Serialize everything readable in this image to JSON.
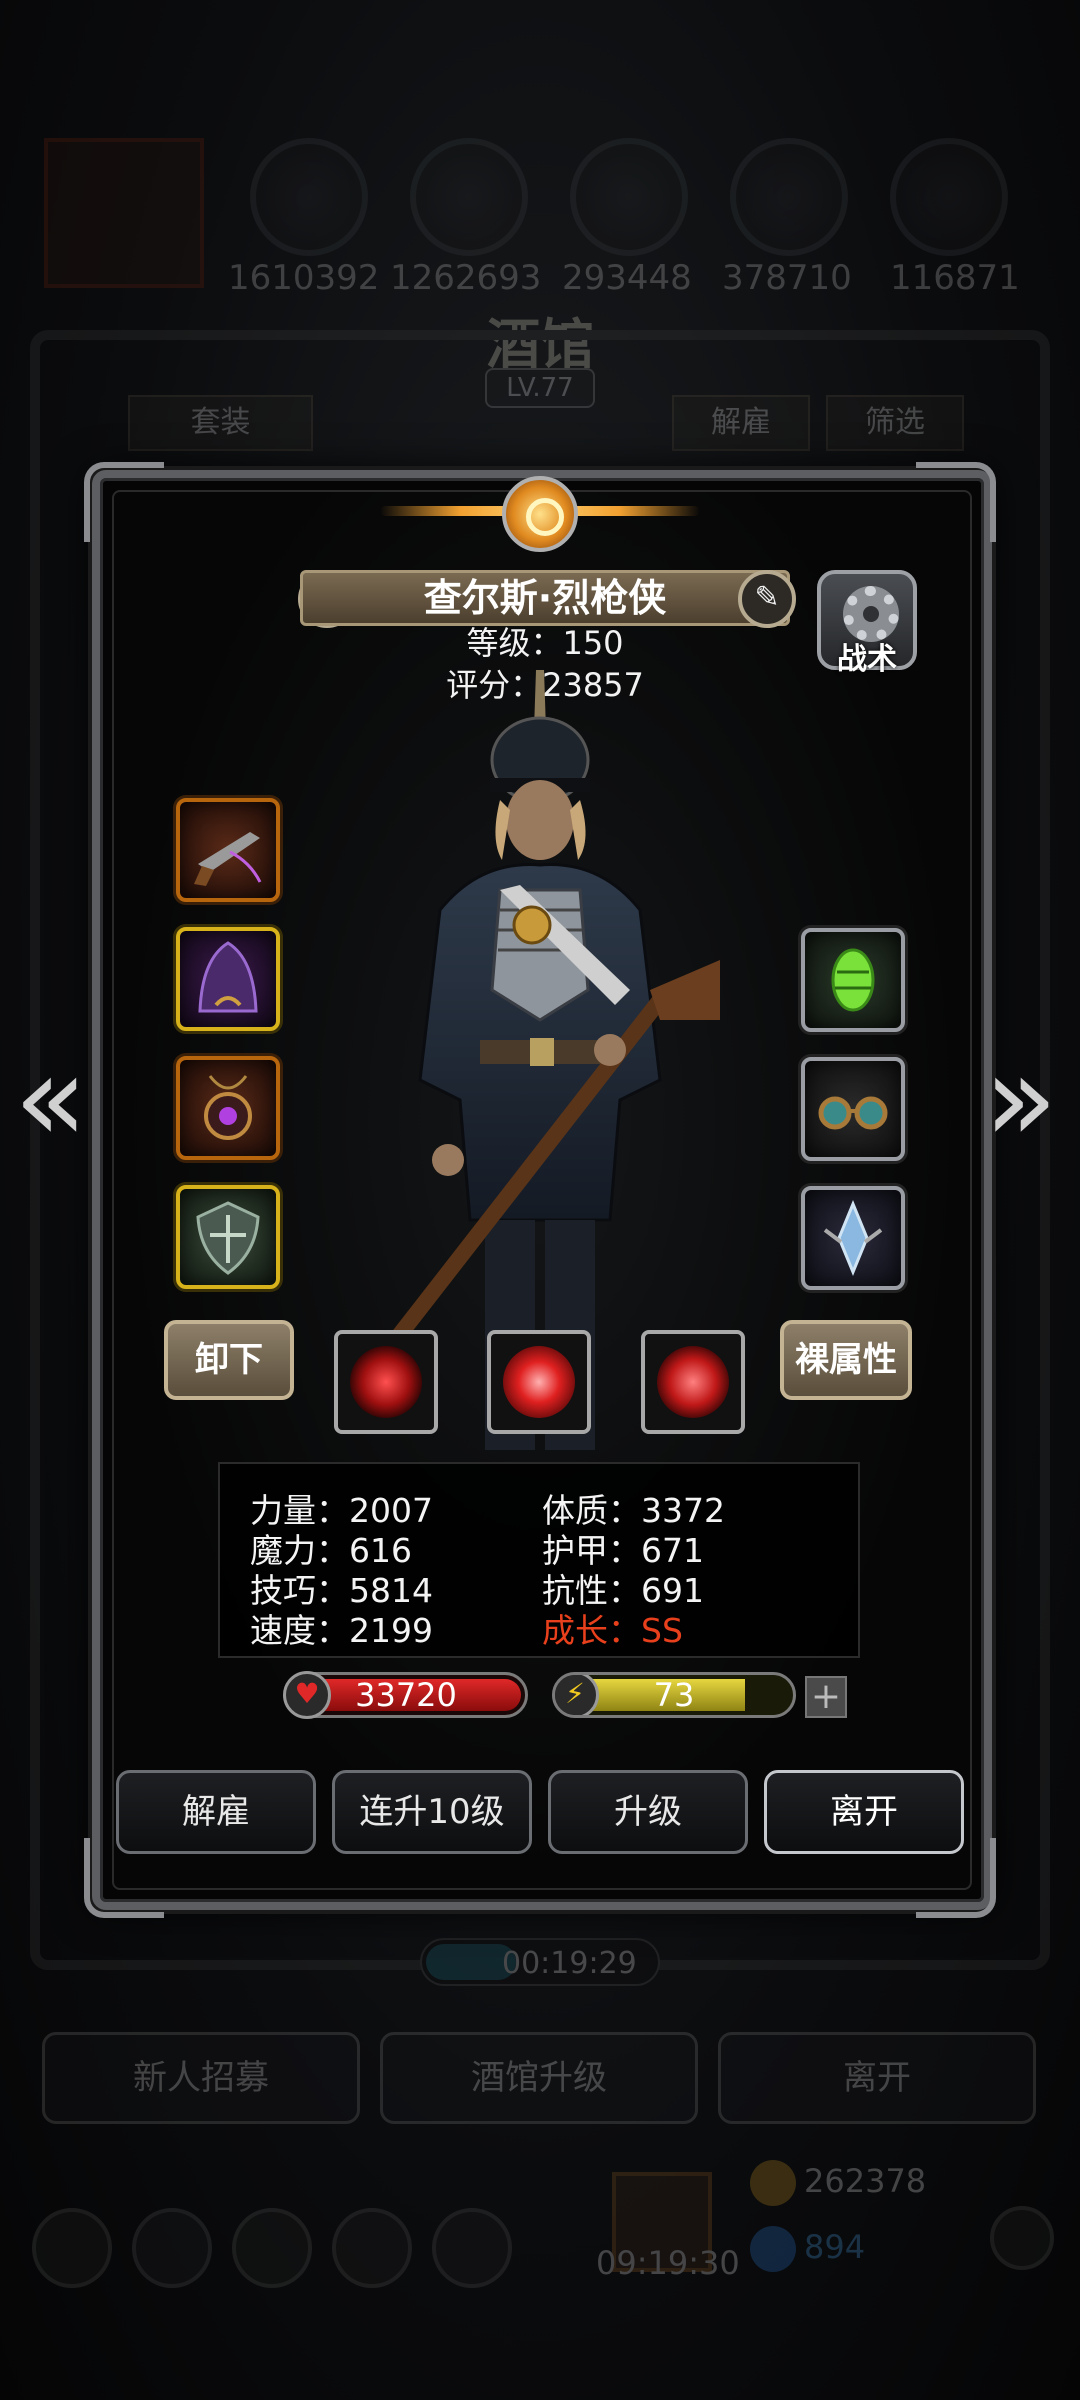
{
  "background": {
    "resources": [
      "1610392",
      "1262693",
      "293448",
      "378710",
      "116871"
    ],
    "title": "酒馆",
    "level": "LV.77",
    "left_button": "套装",
    "right_buttons": [
      "解雇",
      "筛选"
    ],
    "timer": "00:19:29",
    "tabs": [
      "新人招募",
      "酒馆升级",
      "离开"
    ],
    "bottom_gold": "262378",
    "bottom_gems": "894",
    "bottom_time": "09:19:30"
  },
  "hero": {
    "name": "查尔斯·烈枪侠",
    "level_line": "等级：150",
    "score_line": "评分：23857"
  },
  "tactic_label": "战术",
  "unequip_label": "卸下",
  "base_attr_label": "裸属性",
  "stats": {
    "strength": "力量：2007",
    "constitution": "体质：3372",
    "magic": "魔力：616",
    "armor": "护甲：671",
    "skill": "技巧：5814",
    "resistance": "抗性：691",
    "speed": "速度：2199",
    "growth": "成长：SS"
  },
  "hp_value": "33720",
  "energy_value": "73",
  "energy_fraction": 0.78,
  "actions": [
    "解雇",
    "连升10级",
    "升级",
    "离开"
  ],
  "colors": {
    "growth": "#e8401c",
    "hp": "#e02828",
    "energy": "#e6d640"
  }
}
